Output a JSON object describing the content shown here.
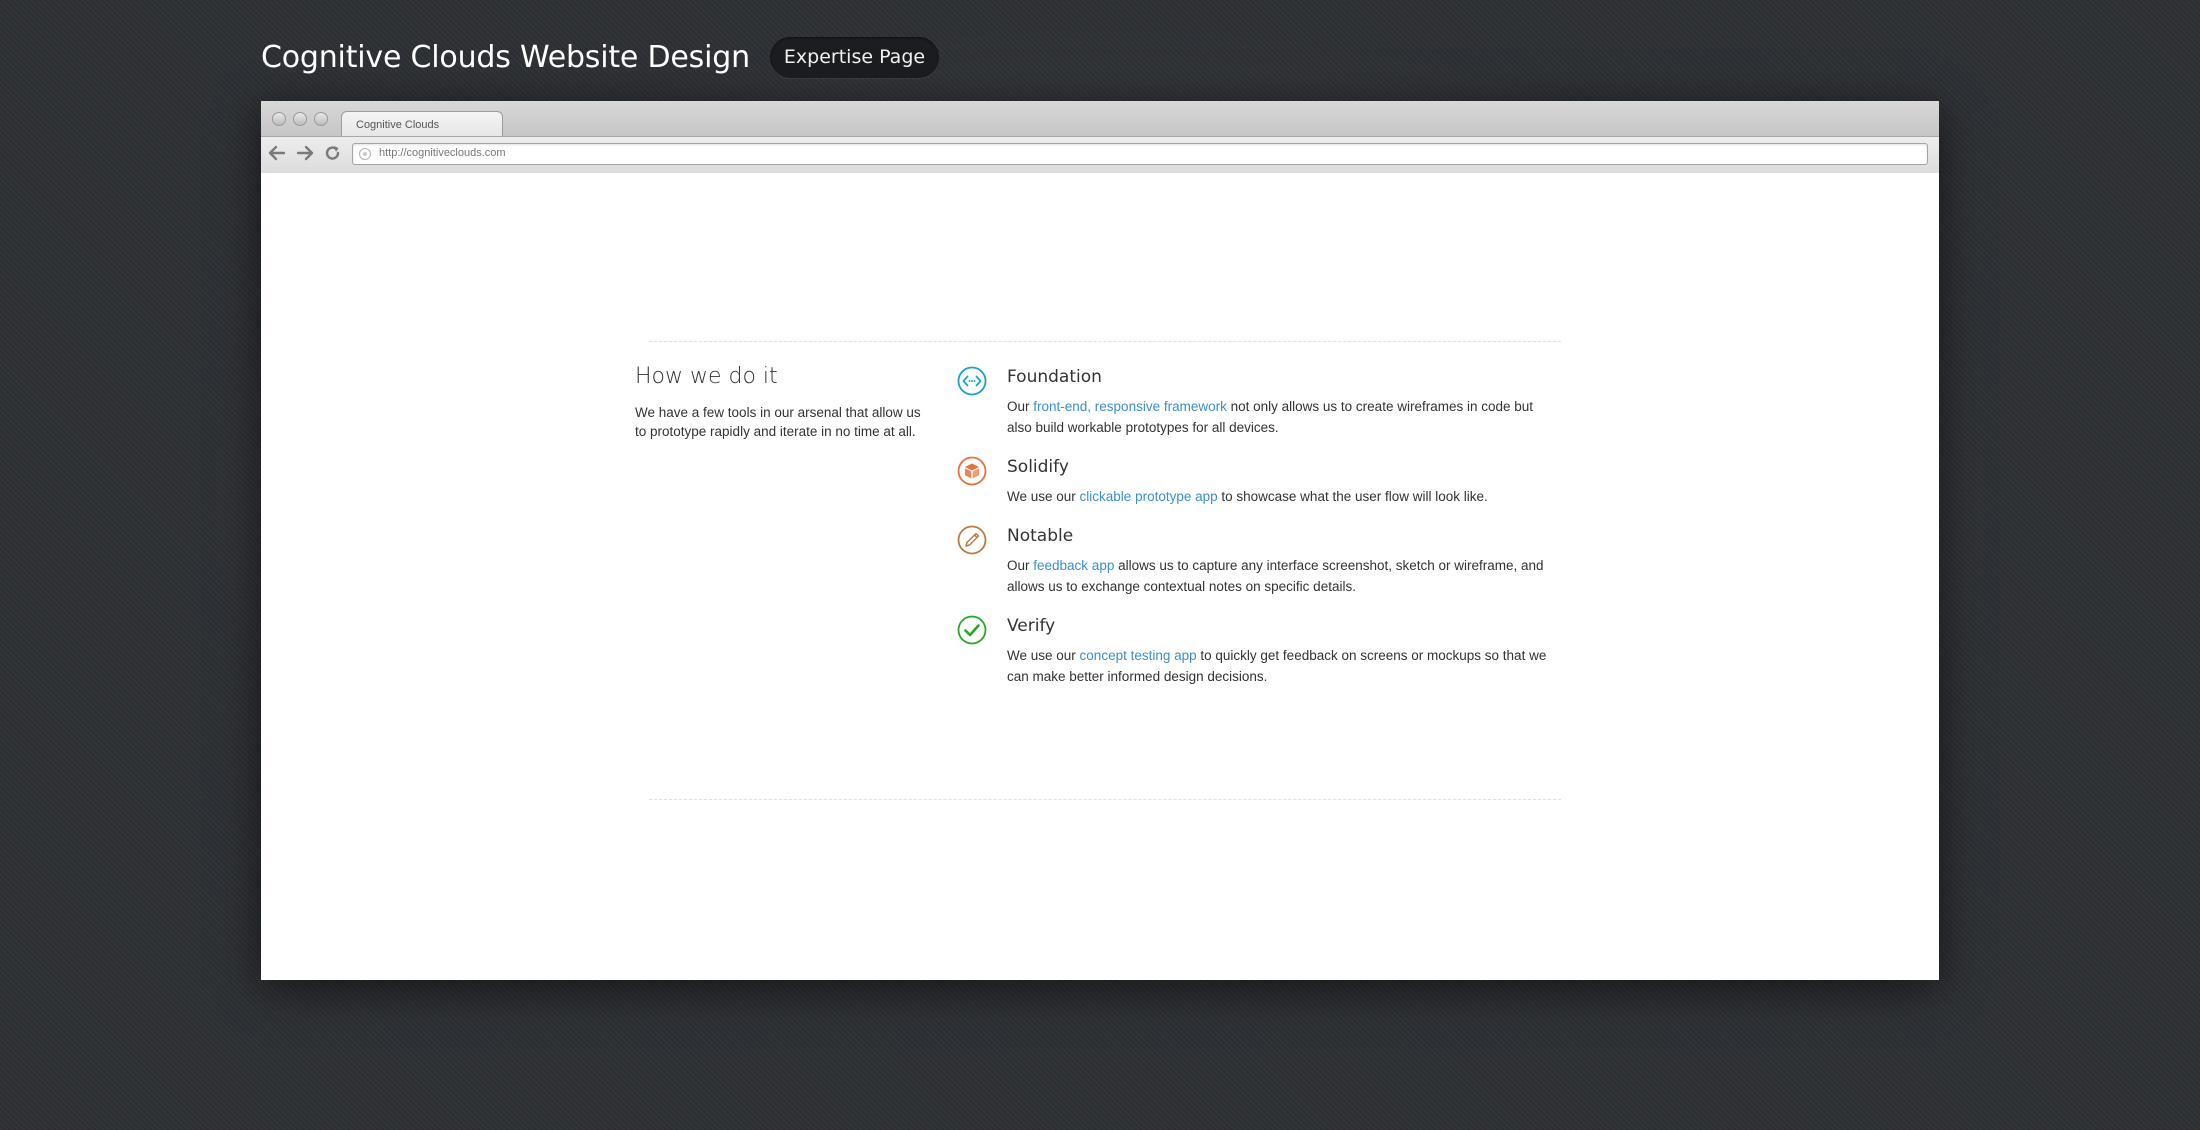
{
  "header": {
    "title": "Cognitive Clouds Website Design",
    "badge": "Expertise Page"
  },
  "browser": {
    "tab_title": "Cognitive Clouds",
    "url": "http://cognitiveclouds.com",
    "icons": [
      "back-arrow-icon",
      "forward-arrow-icon",
      "reload-icon",
      "globe-icon"
    ]
  },
  "page": {
    "intro": {
      "heading": "How we do it",
      "text": "We have a few tools in our arsenal that allow us to prototype rapidly and iterate in no time at all."
    },
    "features": [
      {
        "icon": "code-icon",
        "color": "#1ba3c6",
        "title": "Foundation",
        "pre": "Our ",
        "link": "front-end, responsive framework",
        "post": " not only allows us to create wireframes in code but also build workable prototypes for all devices."
      },
      {
        "icon": "box-icon",
        "color": "#e8703a",
        "title": "Solidify",
        "pre": "We use our ",
        "link": "clickable prototype app",
        "post": " to showcase what the user flow will look like."
      },
      {
        "icon": "pencil-icon",
        "color": "#b87b4a",
        "title": "Notable",
        "pre": "Our ",
        "link": "feedback app",
        "post": " allows us to capture any interface screenshot, sketch or wireframe, and allows us to exchange contextual notes on specific details."
      },
      {
        "icon": "checkmark-icon",
        "color": "#2aa52a",
        "title": "Verify",
        "pre": "We use our ",
        "link": "concept testing app",
        "post": " to quickly get feedback on screens or mockups so that we can make better informed design decisions."
      }
    ]
  },
  "colors": {
    "background": "#2d3034",
    "link": "#3b8fd0"
  }
}
